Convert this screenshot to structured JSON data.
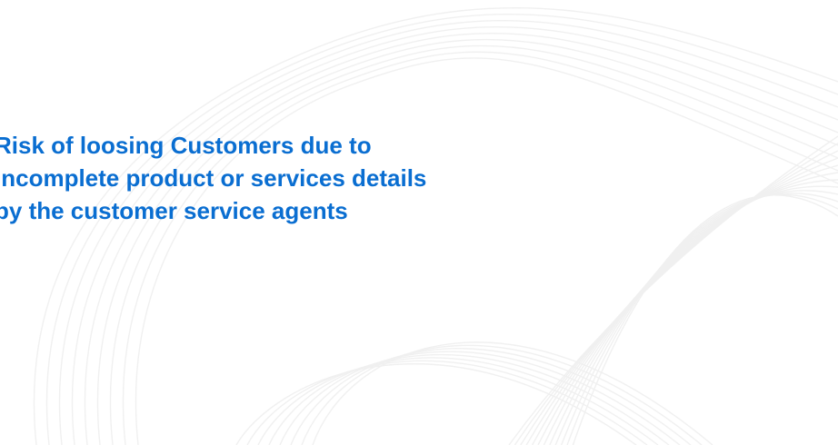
{
  "slide": {
    "headline_lines": [
      "Risk of loosing Customers due to",
      "incomplete product or services details",
      "by the customer service agents"
    ]
  },
  "colors": {
    "headline": "#0a6ed1",
    "background": "#ffffff",
    "pattern_lines": "#f0f0f0"
  }
}
